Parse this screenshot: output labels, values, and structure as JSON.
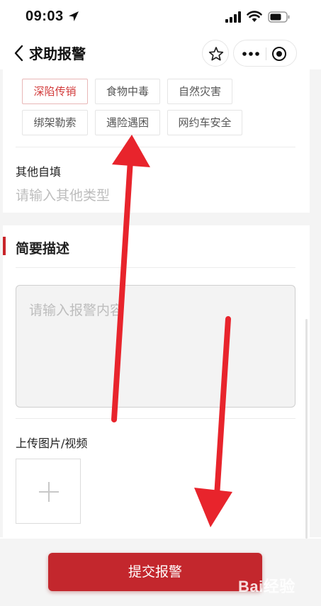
{
  "status_bar": {
    "time": "09:03"
  },
  "nav": {
    "title": "求助报警"
  },
  "report_types": [
    {
      "label": "深陷传销",
      "selected": true
    },
    {
      "label": "食物中毒",
      "selected": false
    },
    {
      "label": "自然灾害",
      "selected": false
    },
    {
      "label": "绑架勒索",
      "selected": false
    },
    {
      "label": "遇险遇困",
      "selected": false
    },
    {
      "label": "网约车安全",
      "selected": false
    }
  ],
  "other": {
    "label": "其他自填",
    "placeholder": "请输入其他类型"
  },
  "description": {
    "section_title": "简要描述",
    "placeholder": "请输入报警内容"
  },
  "upload": {
    "label": "上传图片/视频"
  },
  "submit": {
    "label": "提交报警"
  },
  "watermark": {
    "text": "Bai经验"
  },
  "colors": {
    "accent": "#c3272d",
    "arrow": "#e8242c"
  }
}
